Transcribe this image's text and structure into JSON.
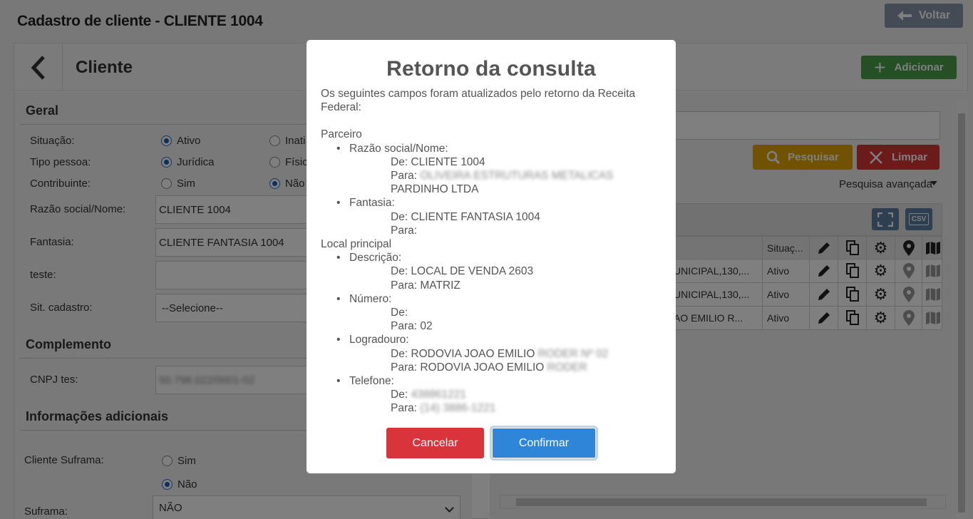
{
  "page": {
    "title": "Cadastro de cliente - CLIENTE 1004",
    "back_label": "Voltar"
  },
  "card": {
    "title": "Cliente",
    "add_label": "Adicionar"
  },
  "form": {
    "geral_title": "Geral",
    "situacao": {
      "label": "Situação:",
      "opt1": "Ativo",
      "opt2": "Inati",
      "selected": "Ativo"
    },
    "tipo_pessoa": {
      "label": "Tipo pessoa:",
      "opt1": "Jurídica",
      "opt2": "Físic",
      "selected": "Jurídica"
    },
    "contribuinte": {
      "label": "Contribuinte:",
      "opt1": "Sim",
      "opt2": "Não",
      "selected": "Não"
    },
    "razao_social": {
      "label": "Razão social/Nome:",
      "value": "CLIENTE 1004"
    },
    "fantasia": {
      "label": "Fantasia:",
      "value": "CLIENTE FANTASIA 1004"
    },
    "teste": {
      "label": "teste:",
      "value": ""
    },
    "sit_cadastro": {
      "label": "Sit. cadastro:",
      "value": "--Selecione--"
    },
    "complemento_title": "Complemento",
    "cnpj": {
      "label": "CNPJ tes:",
      "value": "50.798.022/0001-02"
    },
    "info_title": "Informações adicionais",
    "cliente_suframa": {
      "label": "Cliente Suframa:",
      "opt1": "Sim",
      "opt2": "Não",
      "selected": "Não"
    },
    "suframa": {
      "label": "Suframa:",
      "value": "NÃO"
    }
  },
  "list": {
    "search_label": "Pesquisar",
    "clear_label": "Limpar",
    "advanced_label": "Pesquisa avançada",
    "csv_label": "CSV",
    "col_situacao": "Situaç...",
    "rows": [
      {
        "endereco": "UNICIPAL,130,...",
        "situacao": "Ativo"
      },
      {
        "endereco": "UNICIPAL,130,...",
        "situacao": "Ativo"
      },
      {
        "endereco": "AO EMILIO R...",
        "situacao": "Ativo"
      }
    ]
  },
  "modal": {
    "title": "Retorno da consulta",
    "intro": "Os seguintes campos foram atualizados pelo retorno da Receita Federal:",
    "parceiro": "Parceiro",
    "razao_label": "Razão social/Nome:",
    "razao_de": "De: CLIENTE 1004",
    "razao_para_prefix": "Para:",
    "razao_para_hidden": "OLIVEIRA ESTRUTURAS METALICAS",
    "razao_para_end": "PARDINHO LTDA",
    "fantasia_label": "Fantasia:",
    "fantasia_de": "De: CLIENTE FANTASIA 1004",
    "fantasia_para": "Para:",
    "local": "Local principal",
    "descricao_label": "Descrição:",
    "descricao_de": "De: LOCAL DE VENDA 2603",
    "descricao_para": "Para: MATRIZ",
    "numero_label": "Número:",
    "numero_de": "De:",
    "numero_para": "Para: 02",
    "logradouro_label": "Logradouro:",
    "logradouro_de": "De: RODOVIA JOAO EMILIO",
    "logradouro_de_hidden": "RODER Nº 02",
    "logradouro_para": "Para: RODOVIA JOAO EMILIO",
    "logradouro_para_hidden": "RODER",
    "telefone_label": "Telefone:",
    "telefone_de": "De:",
    "telefone_de_hidden": "438861221",
    "telefone_para": "Para:",
    "telefone_para_hidden": "(14) 3886-1221",
    "cancel_label": "Cancelar",
    "confirm_label": "Confirmar"
  }
}
